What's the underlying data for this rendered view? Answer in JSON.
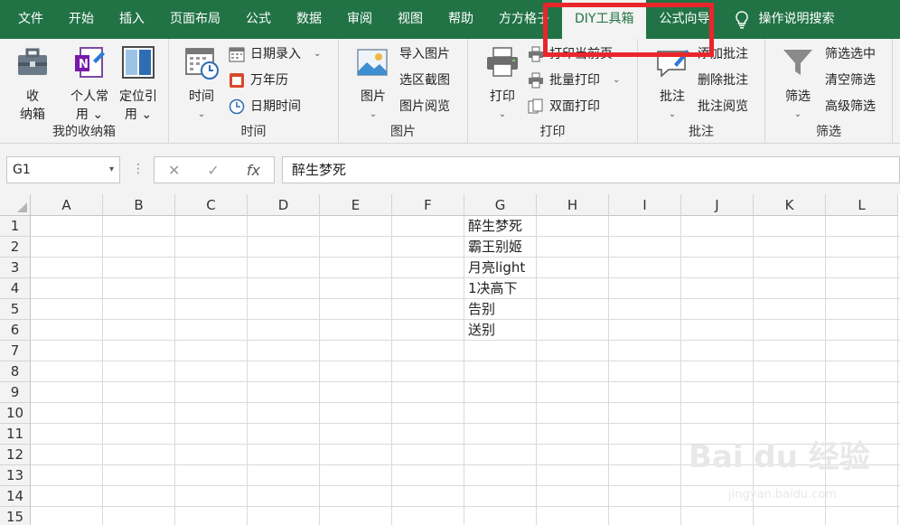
{
  "menubar": {
    "items": [
      "文件",
      "开始",
      "插入",
      "页面布局",
      "公式",
      "数据",
      "审阅",
      "视图",
      "帮助",
      "方方格子",
      "DIY工具箱",
      "公式向导"
    ],
    "active": "DIY工具箱",
    "search": "操作说明搜索"
  },
  "ribbon": {
    "storage": {
      "label": "我的收纳箱",
      "buttons": [
        "收\n纳箱",
        "个人常\n用 ⌄",
        "定位引\n用 ⌄"
      ]
    },
    "time": {
      "label": "时间",
      "big": "时间",
      "items": [
        "日期录入",
        "万年历",
        "日期时间"
      ]
    },
    "picture": {
      "label": "图片",
      "big": "图片",
      "items": [
        "导入图片",
        "选区截图",
        "图片阅览"
      ]
    },
    "print": {
      "label": "打印",
      "big": "打印",
      "items": [
        "打印当前页",
        "批量打印",
        "双面打印"
      ]
    },
    "comment": {
      "label": "批注",
      "big": "批注",
      "items": [
        "添加批注",
        "删除批注",
        "批注阅览"
      ]
    },
    "filter": {
      "label": "筛选",
      "big": "筛选",
      "items": [
        "筛选选中",
        "清空筛选",
        "高级筛选"
      ]
    }
  },
  "formulabar": {
    "namebox": "G1",
    "formula": "醉生梦死",
    "fx": "fx"
  },
  "sheet": {
    "columns": [
      "A",
      "B",
      "C",
      "D",
      "E",
      "F",
      "G",
      "H",
      "I",
      "J",
      "K",
      "L"
    ],
    "rows": [
      "1",
      "2",
      "3",
      "4",
      "5",
      "6",
      "7",
      "8",
      "9",
      "10",
      "11",
      "12",
      "13",
      "14",
      "15"
    ],
    "g_column": [
      "醉生梦死",
      "霸王别姬",
      "月亮light",
      "1决高下",
      "告别",
      "送别"
    ]
  },
  "watermark": {
    "main": "Bai du 经验",
    "sub": "jingyan.baidu.com"
  },
  "colors": {
    "excel_green": "#217346",
    "highlight_red": "#e8262b"
  }
}
